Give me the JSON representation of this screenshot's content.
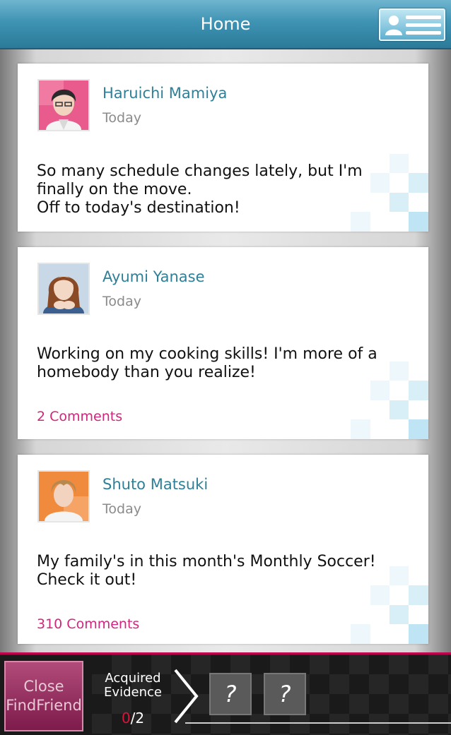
{
  "header": {
    "title": "Home",
    "profile_icon": "profile-list-icon"
  },
  "posts": [
    {
      "name": "Haruichi Mamiya",
      "time": "Today",
      "text": "So many schedule changes lately, but I'm\nfinally on the move.\nOff to today's destination!",
      "comments": ""
    },
    {
      "name": "Ayumi Yanase",
      "time": "Today",
      "text": "Working on my cooking skills! I'm more of a\nhomebody than you realize!",
      "comments": "2 Comments"
    },
    {
      "name": "Shuto Matsuki",
      "time": "Today",
      "text": "My family's in this month's Monthly Soccer!\nCheck it out!",
      "comments": "310 Comments"
    }
  ],
  "bottom": {
    "close_label_1": "Close",
    "close_label_2": "FindFriend",
    "evidence_label_1": "Acquired",
    "evidence_label_2": "Evidence",
    "evidence_got": "0",
    "evidence_total": "/2",
    "slots": [
      "?",
      "?"
    ]
  },
  "colors": {
    "header": "#3f93b3",
    "accent_name": "#2f7f97",
    "comments": "#d0267c",
    "evidence_got": "#e0103a"
  }
}
